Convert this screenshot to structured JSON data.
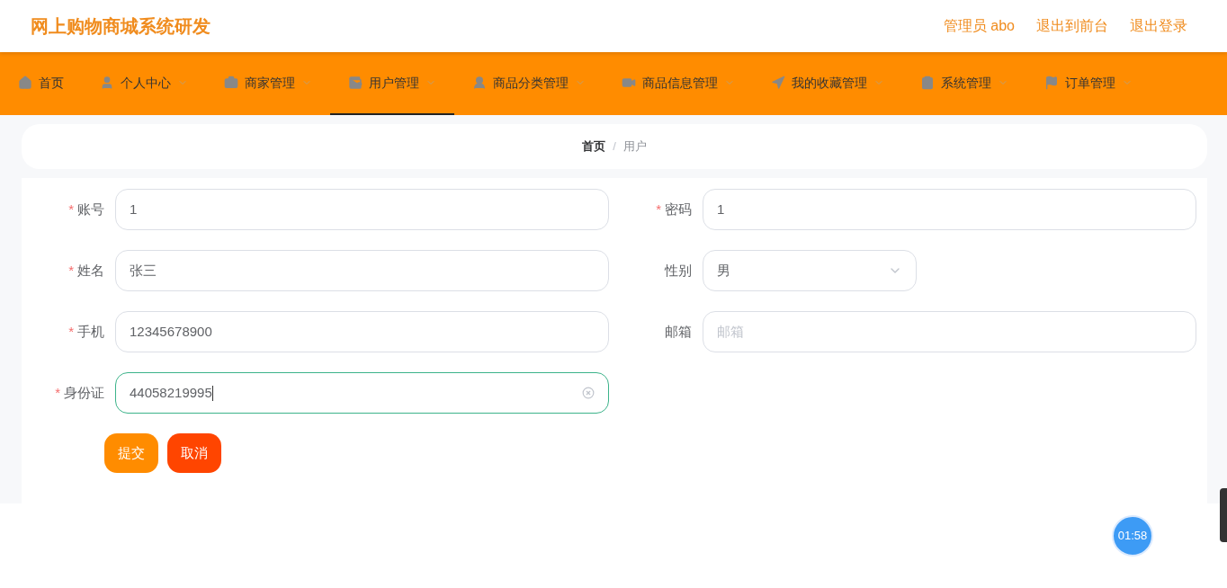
{
  "header": {
    "title": "网上购物商城系统研发",
    "links": [
      "管理员 abo",
      "退出到前台",
      "退出登录"
    ]
  },
  "nav": [
    {
      "label": "首页",
      "selected": false,
      "dropdown": false
    },
    {
      "label": "个人中心",
      "selected": false,
      "dropdown": true
    },
    {
      "label": "商家管理",
      "selected": false,
      "dropdown": true
    },
    {
      "label": "用户管理",
      "selected": true,
      "dropdown": true
    },
    {
      "label": "商品分类管理",
      "selected": false,
      "dropdown": true
    },
    {
      "label": "商品信息管理",
      "selected": false,
      "dropdown": true
    },
    {
      "label": "我的收藏管理",
      "selected": false,
      "dropdown": true
    },
    {
      "label": "系统管理",
      "selected": false,
      "dropdown": true
    },
    {
      "label": "订单管理",
      "selected": false,
      "dropdown": true
    }
  ],
  "breadcrumb": {
    "items": [
      "首页",
      "用户"
    ],
    "separator": "/"
  },
  "form": {
    "rows": [
      [
        {
          "kind": "input",
          "label": "账号",
          "required": true,
          "value": "1",
          "focused": false
        },
        {
          "kind": "input",
          "label": "密码",
          "required": true,
          "value": "1",
          "focused": false
        }
      ],
      [
        {
          "kind": "input",
          "label": "姓名",
          "required": true,
          "value": "张三",
          "focused": false
        },
        {
          "kind": "select",
          "label": "性别",
          "required": false,
          "value": "男",
          "focused": false
        }
      ],
      [
        {
          "kind": "input",
          "label": "手机",
          "required": true,
          "value": "12345678900",
          "focused": false
        },
        {
          "kind": "input",
          "label": "邮箱",
          "required": false,
          "placeholder": "邮箱",
          "focused": false
        }
      ],
      [
        {
          "kind": "input",
          "label": "身份证",
          "required": true,
          "value": "44058219995",
          "focused": true
        }
      ]
    ],
    "required_mark": "*",
    "buttons": [
      {
        "label": "提交",
        "kind": "primary"
      },
      {
        "label": "取消",
        "kind": "danger"
      }
    ]
  },
  "timer": "01:58"
}
